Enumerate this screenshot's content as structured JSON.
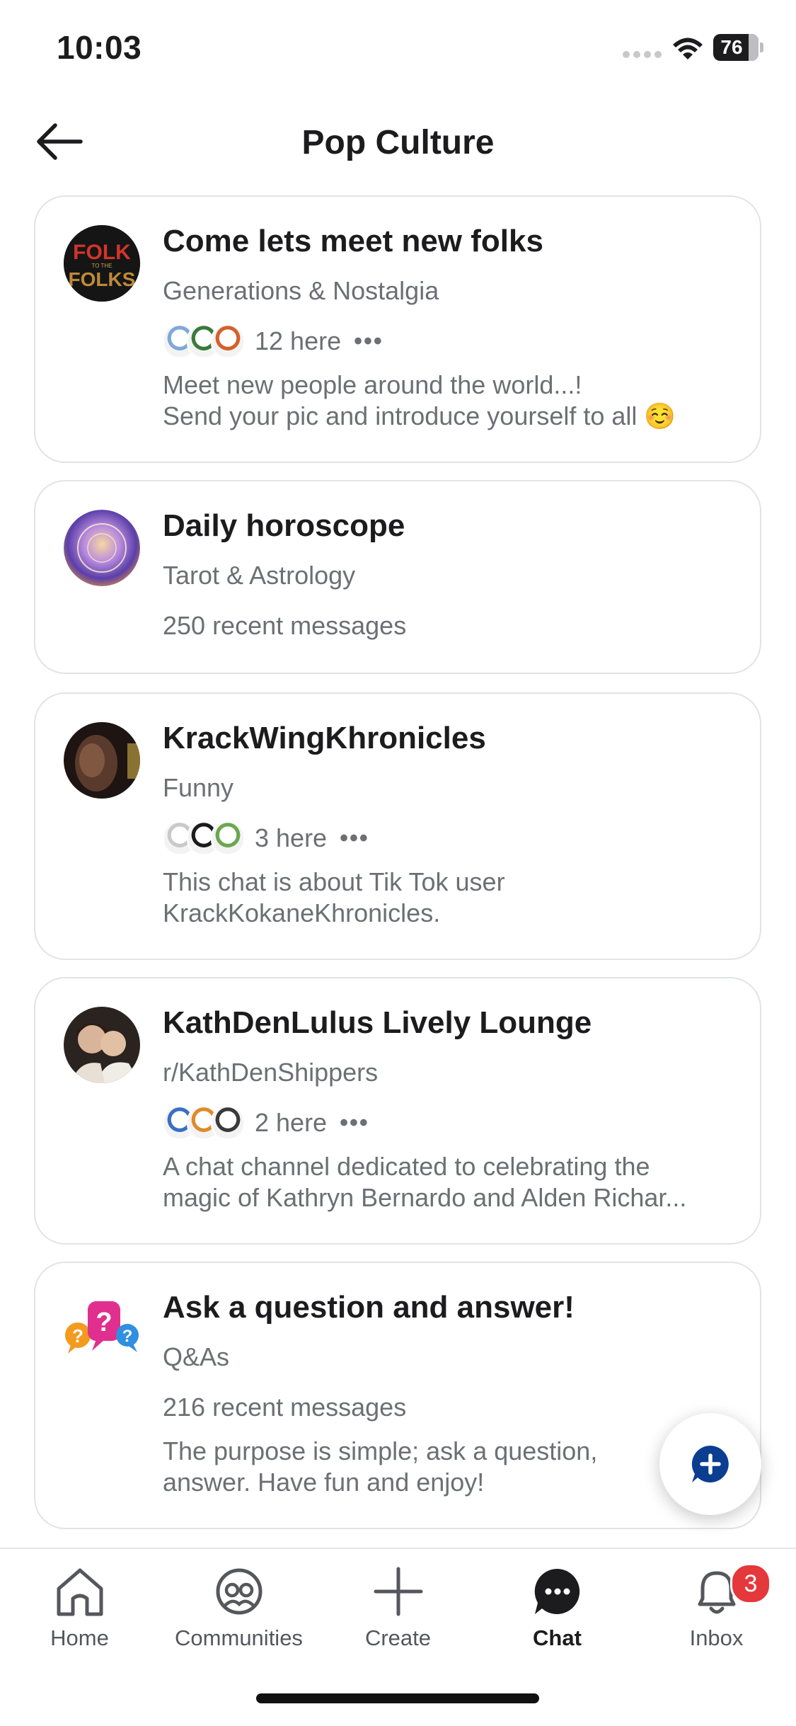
{
  "status_bar": {
    "time": "10:03",
    "battery": "76"
  },
  "header": {
    "title": "Pop Culture"
  },
  "channels": [
    {
      "title": "Come lets meet new folks",
      "community": "Generations & Nostalgia",
      "here": "12 here",
      "recent": "",
      "description": [
        "Meet new people around the world...!",
        "Send your pic and introduce yourself to all ☺️"
      ],
      "avatar_text_top": "FOLK",
      "avatar_text_mid": "TO THE",
      "avatar_text_bot": "FOLKS"
    },
    {
      "title": "Daily horoscope",
      "community": "Tarot & Astrology",
      "here": "",
      "recent": "250 recent messages",
      "description": []
    },
    {
      "title": "KrackWingKhronicles",
      "community": "Funny",
      "here": "3 here",
      "recent": "",
      "description": [
        "This chat is about Tik Tok user",
        "KrackKokaneKhronicles."
      ]
    },
    {
      "title": "KathDenLulus Lively Lounge",
      "community": "r/KathDenShippers",
      "here": "2 here",
      "recent": "",
      "description": [
        "A chat channel dedicated to celebrating the",
        "magic of Kathryn Bernardo and Alden Richar..."
      ]
    },
    {
      "title": "Ask a question and answer!",
      "community": "Q&As",
      "here": "",
      "recent": "216 recent messages",
      "description": [
        "The purpose is simple; ask a question,",
        "answer. Have fun and enjoy!"
      ]
    }
  ],
  "bottom_nav": {
    "home": "Home",
    "communities": "Communities",
    "create": "Create",
    "chat": "Chat",
    "inbox": "Inbox",
    "inbox_badge": "3"
  },
  "colors": {
    "accent": "#0b3d91",
    "badge": "#e5383b",
    "muted": "#6c6f74"
  }
}
